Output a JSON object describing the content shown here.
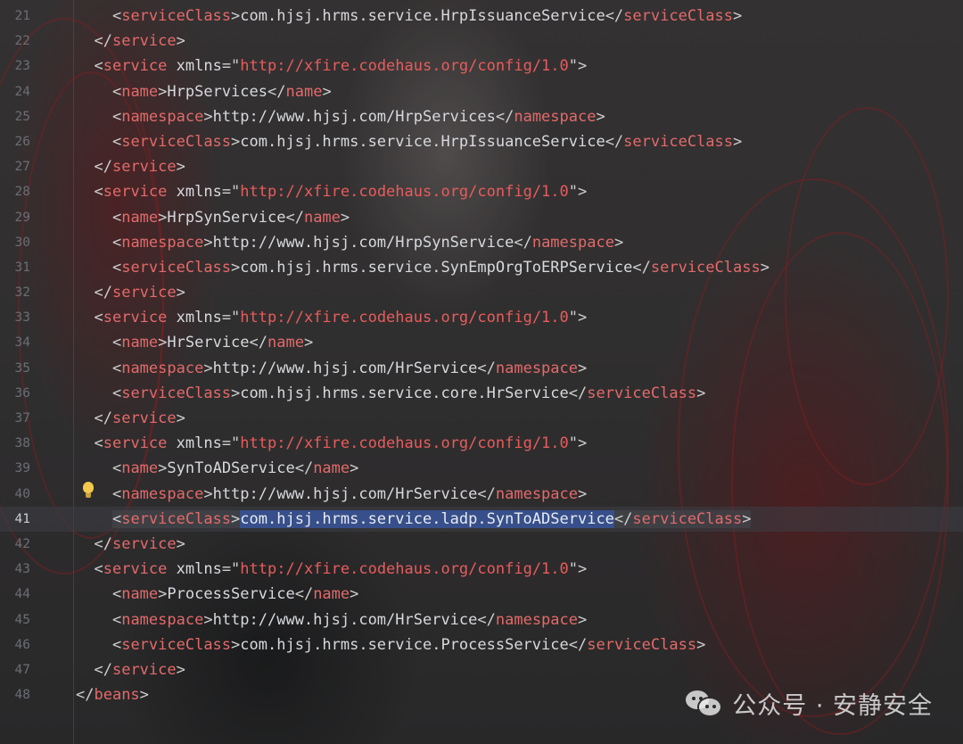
{
  "editor": {
    "active_line": "41",
    "lines": [
      {
        "n": "21",
        "kind": "class",
        "indent": "      ",
        "value": "com.hjsj.hrms.service.HrpIssuanceService"
      },
      {
        "n": "22",
        "kind": "close",
        "indent": "    "
      },
      {
        "n": "23",
        "kind": "open",
        "indent": "    ",
        "value": "http://xfire.codehaus.org/config/1.0"
      },
      {
        "n": "24",
        "kind": "name",
        "indent": "      ",
        "value": "HrpServices"
      },
      {
        "n": "25",
        "kind": "ns",
        "indent": "      ",
        "value": "http://www.hjsj.com/HrpServices"
      },
      {
        "n": "26",
        "kind": "class",
        "indent": "      ",
        "value": "com.hjsj.hrms.service.HrpIssuanceService"
      },
      {
        "n": "27",
        "kind": "close",
        "indent": "    "
      },
      {
        "n": "28",
        "kind": "open",
        "indent": "    ",
        "value": "http://xfire.codehaus.org/config/1.0"
      },
      {
        "n": "29",
        "kind": "name",
        "indent": "      ",
        "value": "HrpSynService"
      },
      {
        "n": "30",
        "kind": "ns",
        "indent": "      ",
        "value": "http://www.hjsj.com/HrpSynService"
      },
      {
        "n": "31",
        "kind": "class",
        "indent": "      ",
        "value": "com.hjsj.hrms.service.SynEmpOrgToERPService"
      },
      {
        "n": "32",
        "kind": "close",
        "indent": "    "
      },
      {
        "n": "33",
        "kind": "open",
        "indent": "    ",
        "value": "http://xfire.codehaus.org/config/1.0"
      },
      {
        "n": "34",
        "kind": "name",
        "indent": "      ",
        "value": "HrService"
      },
      {
        "n": "35",
        "kind": "ns",
        "indent": "      ",
        "value": "http://www.hjsj.com/HrService"
      },
      {
        "n": "36",
        "kind": "class",
        "indent": "      ",
        "value": "com.hjsj.hrms.service.core.HrService"
      },
      {
        "n": "37",
        "kind": "close",
        "indent": "    "
      },
      {
        "n": "38",
        "kind": "open",
        "indent": "    ",
        "value": "http://xfire.codehaus.org/config/1.0"
      },
      {
        "n": "39",
        "kind": "name",
        "indent": "      ",
        "value": "SynToADService"
      },
      {
        "n": "40",
        "kind": "ns",
        "indent": "      ",
        "value": "http://www.hjsj.com/HrService"
      },
      {
        "n": "41",
        "kind": "class",
        "indent": "      ",
        "value": "com.hjsj.hrms.service.ladp.SynToADService",
        "selected": true
      },
      {
        "n": "42",
        "kind": "close",
        "indent": "    "
      },
      {
        "n": "43",
        "kind": "open",
        "indent": "    ",
        "value": "http://xfire.codehaus.org/config/1.0"
      },
      {
        "n": "44",
        "kind": "name",
        "indent": "      ",
        "value": "ProcessService"
      },
      {
        "n": "45",
        "kind": "ns",
        "indent": "      ",
        "value": "http://www.hjsj.com/HrService"
      },
      {
        "n": "46",
        "kind": "class",
        "indent": "      ",
        "value": "com.hjsj.hrms.service.ProcessService"
      },
      {
        "n": "47",
        "kind": "close",
        "indent": "    "
      },
      {
        "n": "48",
        "kind": "beans",
        "indent": "  "
      }
    ],
    "tokens": {
      "service": "service",
      "xmlns": "xmlns",
      "name": "name",
      "namespace": "namespace",
      "serviceClass": "serviceClass",
      "beans": "beans"
    }
  },
  "watermark": {
    "text": "公众号 · 安静安全",
    "icon": "wechat-icon"
  }
}
